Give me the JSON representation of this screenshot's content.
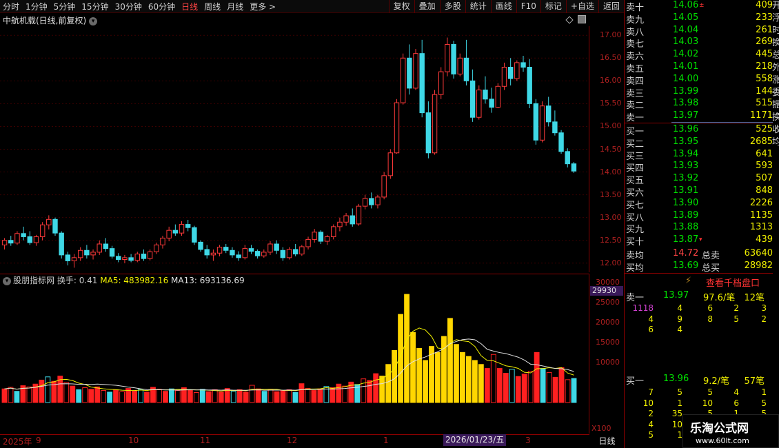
{
  "toolbar": {
    "periods": [
      "分时",
      "1分钟",
      "5分钟",
      "15分钟",
      "30分钟",
      "60分钟",
      "日线",
      "周线",
      "月线",
      "更多 >"
    ],
    "active_period": "日线",
    "tools": [
      "复权",
      "叠加",
      "多股",
      "统计",
      "画线",
      "F10",
      "标记",
      "+自选",
      "返回"
    ]
  },
  "stock_title": "中航机载(日线,前复权)",
  "price_axis": [
    "17.00",
    "16.50",
    "16.00",
    "15.50",
    "15.00",
    "14.50",
    "14.00",
    "13.50",
    "13.00",
    "12.50",
    "12.00"
  ],
  "indicator": {
    "name": "股朋指标网",
    "turnover": "换手: 0.41",
    "ma5": "MA5: 483982.16",
    "ma13": "MA13: 693136.69"
  },
  "vol_axis": [
    "30000",
    "25000",
    "20000",
    "15000",
    "10000"
  ],
  "vol_cursor": "29930",
  "vol_unit": "X100",
  "date_axis": [
    "2025年",
    "9",
    "10",
    "11",
    "12",
    "1",
    "3"
  ],
  "cursor_date": "2026/01/23/五",
  "period_tab": "日线",
  "order_book": {
    "asks": [
      {
        "label": "卖十",
        "price": "14.06",
        "qty": "409",
        "mark": "±"
      },
      {
        "label": "卖九",
        "price": "14.05",
        "qty": "233"
      },
      {
        "label": "卖八",
        "price": "14.04",
        "qty": "261"
      },
      {
        "label": "卖七",
        "price": "14.03",
        "qty": "269"
      },
      {
        "label": "卖六",
        "price": "14.02",
        "qty": "445"
      },
      {
        "label": "卖五",
        "price": "14.01",
        "qty": "218"
      },
      {
        "label": "卖四",
        "price": "14.00",
        "qty": "558"
      },
      {
        "label": "卖三",
        "price": "13.99",
        "qty": "144"
      },
      {
        "label": "卖二",
        "price": "13.98",
        "qty": "515"
      },
      {
        "label": "卖一",
        "price": "13.97",
        "qty": "1171"
      }
    ],
    "bids": [
      {
        "label": "买一",
        "price": "13.96",
        "qty": "525"
      },
      {
        "label": "买二",
        "price": "13.95",
        "qty": "2685"
      },
      {
        "label": "买三",
        "price": "13.94",
        "qty": "641"
      },
      {
        "label": "买四",
        "price": "13.93",
        "qty": "593"
      },
      {
        "label": "买五",
        "price": "13.92",
        "qty": "507"
      },
      {
        "label": "买六",
        "price": "13.91",
        "qty": "848"
      },
      {
        "label": "买七",
        "price": "13.90",
        "qty": "2226"
      },
      {
        "label": "买八",
        "price": "13.89",
        "qty": "1135"
      },
      {
        "label": "买九",
        "price": "13.88",
        "qty": "1313"
      },
      {
        "label": "买十",
        "price": "13.87",
        "qty": "439",
        "mark": "▾"
      }
    ],
    "sell_avg": {
      "label": "卖均",
      "price": "14.72",
      "total_label": "总卖",
      "total": "63640"
    },
    "buy_avg": {
      "label": "买均",
      "price": "13.69",
      "total_label": "总买",
      "total": "28982"
    },
    "depth_button": "查看千档盘口",
    "queue_ask": {
      "label": "卖一",
      "price": "13.97",
      "avg": "97.6/笔",
      "count": "12笔",
      "rows": [
        [
          "1118",
          "4",
          "6",
          "2",
          "3"
        ],
        [
          "4",
          "9",
          "8",
          "5",
          "2"
        ],
        [
          "6",
          "4",
          "",
          "",
          ""
        ]
      ]
    },
    "queue_bid": {
      "label": "买一",
      "price": "13.96",
      "avg": "9.2/笔",
      "count": "57笔",
      "rows": [
        [
          "7",
          "5",
          "5",
          "4",
          "1"
        ],
        [
          "10",
          "1",
          "10",
          "6",
          "5"
        ],
        [
          "2",
          "35",
          "5",
          "1",
          "5"
        ],
        [
          "4",
          "10",
          "",
          "",
          ""
        ],
        [
          "5",
          "1",
          "",
          "",
          ""
        ]
      ]
    }
  },
  "right_strip": "开浮时换总外涨委振换收均",
  "watermark": {
    "line1": "乐淘公式网",
    "line2": "www.60lt.com"
  },
  "chart_data": [
    {
      "type": "candlestick",
      "title": "中航机载(日线,前复权)",
      "ylim": [
        11.8,
        17.2
      ],
      "candles_ohlc": [
        [
          12.4,
          12.55,
          12.3,
          12.5
        ],
        [
          12.5,
          12.6,
          12.38,
          12.44
        ],
        [
          12.44,
          12.7,
          12.4,
          12.65
        ],
        [
          12.65,
          12.8,
          12.5,
          12.58
        ],
        [
          12.58,
          12.7,
          12.4,
          12.45
        ],
        [
          12.45,
          12.62,
          12.38,
          12.58
        ],
        [
          12.58,
          12.9,
          12.5,
          12.84
        ],
        [
          12.84,
          13.05,
          12.74,
          12.96
        ],
        [
          12.96,
          13.0,
          12.6,
          12.66
        ],
        [
          12.66,
          12.7,
          12.1,
          12.18
        ],
        [
          12.18,
          12.25,
          11.95,
          12.05
        ],
        [
          12.05,
          12.2,
          11.9,
          12.12
        ],
        [
          12.12,
          12.35,
          12.05,
          12.28
        ],
        [
          12.28,
          12.4,
          12.1,
          12.18
        ],
        [
          12.18,
          12.3,
          12.08,
          12.24
        ],
        [
          12.24,
          12.5,
          12.18,
          12.42
        ],
        [
          12.42,
          12.55,
          12.25,
          12.32
        ],
        [
          12.32,
          12.38,
          12.1,
          12.15
        ],
        [
          12.15,
          12.22,
          12.02,
          12.08
        ],
        [
          12.08,
          12.18,
          12.0,
          12.12
        ],
        [
          12.12,
          12.2,
          12.02,
          12.06
        ],
        [
          12.06,
          12.25,
          12.02,
          12.2
        ],
        [
          12.2,
          12.3,
          12.05,
          12.1
        ],
        [
          12.1,
          12.3,
          12.06,
          12.25
        ],
        [
          12.25,
          12.45,
          12.2,
          12.4
        ],
        [
          12.4,
          12.6,
          12.32,
          12.55
        ],
        [
          12.55,
          12.8,
          12.48,
          12.72
        ],
        [
          12.72,
          12.85,
          12.6,
          12.66
        ],
        [
          12.66,
          12.92,
          12.6,
          12.85
        ],
        [
          12.85,
          12.95,
          12.7,
          12.78
        ],
        [
          12.78,
          12.82,
          12.4,
          12.46
        ],
        [
          12.46,
          12.5,
          12.25,
          12.3
        ],
        [
          12.3,
          12.4,
          12.1,
          12.18
        ],
        [
          12.18,
          12.3,
          12.05,
          12.22
        ],
        [
          12.22,
          12.4,
          12.15,
          12.35
        ],
        [
          12.35,
          12.42,
          12.22,
          12.28
        ],
        [
          12.28,
          12.35,
          12.12,
          12.18
        ],
        [
          12.18,
          12.26,
          12.05,
          12.12
        ],
        [
          12.12,
          12.4,
          12.08,
          12.32
        ],
        [
          12.32,
          12.4,
          12.2,
          12.26
        ],
        [
          12.26,
          12.3,
          12.1,
          12.16
        ],
        [
          12.16,
          12.3,
          12.12,
          12.24
        ],
        [
          12.24,
          12.48,
          12.18,
          12.42
        ],
        [
          12.42,
          12.5,
          12.2,
          12.28
        ],
        [
          12.28,
          12.35,
          12.05,
          12.12
        ],
        [
          12.12,
          12.35,
          12.08,
          12.3
        ],
        [
          12.3,
          12.42,
          12.15,
          12.2
        ],
        [
          12.2,
          12.4,
          12.16,
          12.36
        ],
        [
          12.36,
          12.58,
          12.3,
          12.52
        ],
        [
          12.52,
          12.75,
          12.45,
          12.68
        ],
        [
          12.68,
          12.72,
          12.42,
          12.48
        ],
        [
          12.48,
          12.62,
          12.4,
          12.58
        ],
        [
          12.58,
          12.85,
          12.52,
          12.8
        ],
        [
          12.8,
          13.0,
          12.7,
          12.9
        ],
        [
          12.9,
          13.1,
          12.82,
          13.04
        ],
        [
          13.04,
          13.2,
          12.8,
          12.86
        ],
        [
          12.86,
          13.3,
          12.82,
          13.25
        ],
        [
          13.25,
          13.5,
          13.18,
          13.42
        ],
        [
          13.42,
          13.55,
          13.2,
          13.28
        ],
        [
          13.28,
          13.5,
          13.2,
          13.45
        ],
        [
          13.45,
          14.0,
          13.4,
          13.92
        ],
        [
          13.92,
          14.5,
          13.85,
          14.42
        ],
        [
          14.42,
          15.6,
          14.4,
          15.52
        ],
        [
          15.52,
          16.6,
          15.48,
          16.5
        ],
        [
          16.5,
          16.8,
          15.7,
          15.84
        ],
        [
          15.84,
          16.7,
          15.8,
          16.6
        ],
        [
          16.6,
          16.9,
          15.2,
          15.3
        ],
        [
          15.3,
          15.55,
          14.3,
          14.42
        ],
        [
          14.42,
          15.8,
          14.38,
          15.7
        ],
        [
          15.7,
          16.3,
          15.6,
          16.2
        ],
        [
          16.2,
          16.95,
          16.1,
          16.8
        ],
        [
          16.8,
          16.88,
          16.05,
          16.15
        ],
        [
          16.15,
          16.6,
          16.1,
          16.5
        ],
        [
          16.5,
          16.9,
          15.9,
          16.0
        ],
        [
          16.0,
          16.25,
          15.1,
          15.2
        ],
        [
          15.2,
          15.9,
          15.15,
          15.8
        ],
        [
          15.8,
          16.1,
          15.5,
          15.6
        ],
        [
          15.6,
          15.85,
          15.3,
          15.42
        ],
        [
          15.42,
          15.95,
          15.4,
          15.88
        ],
        [
          15.88,
          16.4,
          15.8,
          16.3
        ],
        [
          16.3,
          16.5,
          15.9,
          16.05
        ],
        [
          16.05,
          16.45,
          16.0,
          16.4
        ],
        [
          16.4,
          16.55,
          16.2,
          16.3
        ],
        [
          16.3,
          16.48,
          15.4,
          15.5
        ],
        [
          15.5,
          15.6,
          14.6,
          14.7
        ],
        [
          14.7,
          15.55,
          14.65,
          15.45
        ],
        [
          15.45,
          15.65,
          15.0,
          15.1
        ],
        [
          15.1,
          15.35,
          14.8,
          14.86
        ],
        [
          14.86,
          14.92,
          14.4,
          14.45
        ],
        [
          14.45,
          14.52,
          14.1,
          14.18
        ],
        [
          14.18,
          14.22,
          13.98,
          14.02
        ]
      ]
    },
    {
      "type": "bar",
      "title": "股朋指标网",
      "ylim": [
        0,
        32000
      ],
      "values": [
        3400,
        3800,
        2800,
        4200,
        3900,
        4600,
        5600,
        6400,
        5300,
        6600,
        5000,
        4100,
        3200,
        3700,
        3300,
        3900,
        3000,
        2600,
        3200,
        2700,
        3500,
        2900,
        3300,
        2600,
        3800,
        3300,
        2800,
        3400,
        3000,
        3700,
        3200,
        2500,
        3300,
        2700,
        3200,
        2600,
        3500,
        2800,
        3200,
        2600,
        4300,
        3400,
        2800,
        3300,
        2700,
        3000,
        3200,
        2500,
        4700,
        3500,
        3000,
        3400,
        4000,
        3700,
        4600,
        4100,
        5100,
        4500,
        5900,
        5500,
        7200,
        6600,
        9500,
        13000,
        22000,
        27000,
        17500,
        13500,
        10500,
        14000,
        12500,
        16500,
        21000,
        14500,
        12500,
        11500,
        10500,
        9500,
        8500,
        12000,
        8500,
        7300,
        8300,
        6500,
        7100,
        7800,
        12500,
        8500,
        7500,
        6300,
        8700,
        5700,
        6000
      ],
      "highlight_indexes": [
        61,
        62,
        63,
        64,
        65,
        66,
        67,
        68,
        69,
        70,
        71,
        72,
        73,
        74,
        75,
        76,
        77
      ],
      "ma5": "483982.16",
      "ma13": "693136.69"
    }
  ]
}
